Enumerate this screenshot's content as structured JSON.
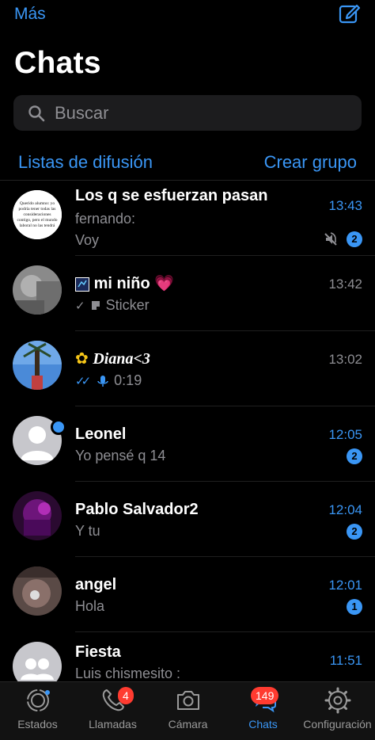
{
  "header": {
    "more_label": "Más",
    "title": "Chats",
    "search_placeholder": "Buscar"
  },
  "links": {
    "broadcast": "Listas de difusión",
    "new_group": "Crear grupo"
  },
  "chats": [
    {
      "name": "Los q se esfuerzan pasan",
      "sender": "fernando:",
      "preview": "Voy",
      "time": "13:43",
      "unread": "2",
      "muted": true,
      "avatar_text": "Querido alumno: yo podría tener todas las consideraciones contigo, pero el mundo laboral no las tendrá"
    },
    {
      "name": "mi niño",
      "preview": "Sticker",
      "time": "13:42",
      "status": "sent"
    },
    {
      "name": "Diana<3",
      "preview": "0:19",
      "time": "13:02",
      "status": "read"
    },
    {
      "name": "Leonel",
      "preview": "Yo pensé q 14",
      "time": "12:05",
      "unread": "2"
    },
    {
      "name": "Pablo Salvador2",
      "preview": "Y tu",
      "time": "12:04",
      "unread": "2"
    },
    {
      "name": "angel",
      "preview": "Hola",
      "time": "12:01",
      "unread": "1"
    },
    {
      "name": "Fiesta",
      "preview": "Luis chismesito :",
      "time": "11:51"
    }
  ],
  "tabs": [
    {
      "label": "Estados",
      "icon": "status-icon"
    },
    {
      "label": "Llamadas",
      "icon": "phone-icon",
      "badge": "4"
    },
    {
      "label": "Cámara",
      "icon": "camera-icon"
    },
    {
      "label": "Chats",
      "icon": "chats-icon",
      "badge": "149",
      "active": true
    },
    {
      "label": "Configuración",
      "icon": "gear-icon"
    }
  ],
  "colors": {
    "accent": "#3a96f5",
    "background": "#000000",
    "secondary_text": "#8e8e93",
    "badge_red": "#ff3b30"
  }
}
